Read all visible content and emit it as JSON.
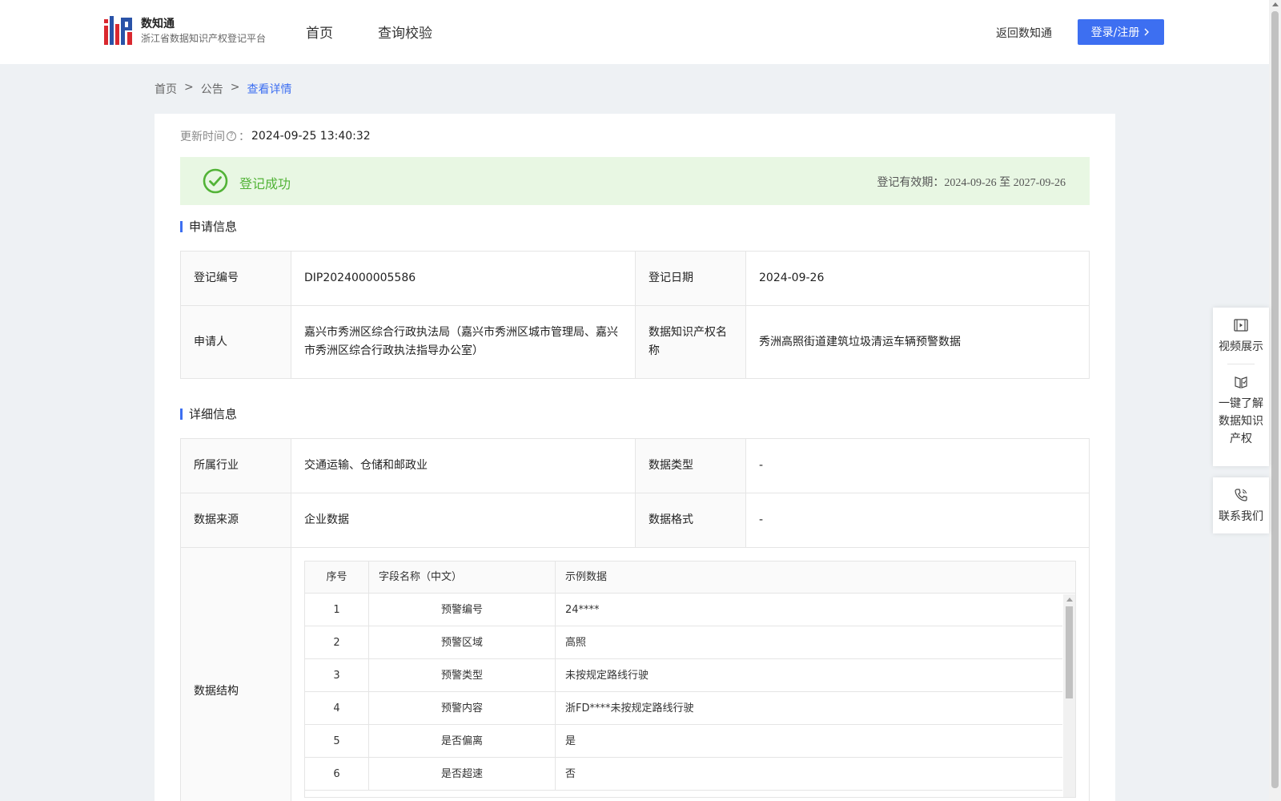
{
  "header": {
    "logo_name": "数知通",
    "logo_sub": "浙江省数据知识产权登记平台",
    "nav": [
      "首页",
      "查询校验"
    ],
    "back_link": "返回数知通",
    "login_label": "登录/注册",
    "accent_color": "#3d6ff1"
  },
  "breadcrumb": [
    "首页",
    ">",
    "公告",
    ">",
    "查看详情"
  ],
  "update": {
    "label": "更新时间",
    "help_glyph": "?",
    "separator": "：",
    "value": "2024-09-25 13:40:32"
  },
  "status": {
    "text": "登记成功",
    "validity_label": "登记有效期：",
    "validity_range": "2024-09-26 至 2027-09-26",
    "color": "#52b337"
  },
  "sections": {
    "apply_title": "申请信息",
    "detail_title": "详细信息"
  },
  "apply": {
    "reg_no_label": "登记编号",
    "reg_no": "DIP2024000005586",
    "reg_date_label": "登记日期",
    "reg_date": "2024-09-26",
    "applicant_label": "申请人",
    "applicant": "嘉兴市秀洲区综合行政执法局（嘉兴市秀洲区城市管理局、嘉兴市秀洲区综合行政执法指导办公室）",
    "ip_name_label": "数据知识产权名称",
    "ip_name": "秀洲高照街道建筑垃圾清运车辆预警数据"
  },
  "detail": {
    "industry_label": "所属行业",
    "industry": "交通运输、仓储和邮政业",
    "data_type_label": "数据类型",
    "data_type": "-",
    "source_label": "数据来源",
    "source": "企业数据",
    "format_label": "数据格式",
    "format": "-",
    "structure_label": "数据结构"
  },
  "structure": {
    "headers": [
      "序号",
      "字段名称（中文）",
      "示例数据"
    ],
    "rows": [
      {
        "no": "1",
        "field": "预警编号",
        "sample": "24****"
      },
      {
        "no": "2",
        "field": "预警区域",
        "sample": "高照"
      },
      {
        "no": "3",
        "field": "预警类型",
        "sample": "未按规定路线行驶"
      },
      {
        "no": "4",
        "field": "预警内容",
        "sample": "浙FD****未按规定路线行驶"
      },
      {
        "no": "5",
        "field": "是否偏离",
        "sample": "是"
      },
      {
        "no": "6",
        "field": "是否超速",
        "sample": "否"
      }
    ]
  },
  "float_panel": {
    "video": "视频展示",
    "learn": "一键了解数据知识产权",
    "contact": "联系我们"
  }
}
